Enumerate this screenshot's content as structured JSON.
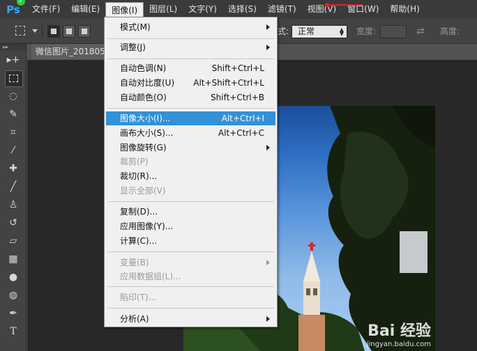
{
  "app": {
    "logo": "Ps",
    "badge": "✓"
  },
  "menubar": {
    "items": [
      "文件(F)",
      "编辑(E)",
      "图像(I)",
      "图层(L)",
      "文字(Y)",
      "选择(S)",
      "滤镜(T)",
      "视图(V)",
      "窗口(W)",
      "帮助(H)"
    ],
    "active": "图像(I)"
  },
  "options": {
    "style_label": "式:",
    "style_value": "正常",
    "width_label": "宽度:",
    "height_label": "高度:"
  },
  "document": {
    "tab_title": "微信图片_201805"
  },
  "image_menu": {
    "items": [
      {
        "label": "模式(M)",
        "shortcut": "",
        "submenu": true,
        "disabled": false
      },
      {
        "label": "调整(J)",
        "shortcut": "",
        "submenu": true,
        "disabled": false
      },
      {
        "label": "自动色调(N)",
        "shortcut": "Shift+Ctrl+L",
        "submenu": false,
        "disabled": false
      },
      {
        "label": "自动对比度(U)",
        "shortcut": "Alt+Shift+Ctrl+L",
        "submenu": false,
        "disabled": false
      },
      {
        "label": "自动颜色(O)",
        "shortcut": "Shift+Ctrl+B",
        "submenu": false,
        "disabled": false
      },
      {
        "label": "图像大小(I)...",
        "shortcut": "Alt+Ctrl+I",
        "submenu": false,
        "disabled": false,
        "highlighted": true
      },
      {
        "label": "画布大小(S)...",
        "shortcut": "Alt+Ctrl+C",
        "submenu": false,
        "disabled": false
      },
      {
        "label": "图像旋转(G)",
        "shortcut": "",
        "submenu": true,
        "disabled": false
      },
      {
        "label": "裁剪(P)",
        "shortcut": "",
        "submenu": false,
        "disabled": true
      },
      {
        "label": "裁切(R)...",
        "shortcut": "",
        "submenu": false,
        "disabled": false
      },
      {
        "label": "显示全部(V)",
        "shortcut": "",
        "submenu": false,
        "disabled": true
      },
      {
        "label": "复制(D)...",
        "shortcut": "",
        "submenu": false,
        "disabled": false
      },
      {
        "label": "应用图像(Y)...",
        "shortcut": "",
        "submenu": false,
        "disabled": false
      },
      {
        "label": "计算(C)...",
        "shortcut": "",
        "submenu": false,
        "disabled": false
      },
      {
        "label": "变量(B)",
        "shortcut": "",
        "submenu": true,
        "disabled": true
      },
      {
        "label": "应用数据组(L)...",
        "shortcut": "",
        "submenu": false,
        "disabled": true
      },
      {
        "label": "陷印(T)...",
        "shortcut": "",
        "submenu": false,
        "disabled": true
      },
      {
        "label": "分析(A)",
        "shortcut": "",
        "submenu": true,
        "disabled": false
      }
    ]
  },
  "watermark": {
    "brand": "Bai 经验",
    "url": "jingyan.baidu.com"
  },
  "colors": {
    "highlight": "#3391d7",
    "menubar": "#3a3a3a",
    "canvas": "#282828"
  }
}
